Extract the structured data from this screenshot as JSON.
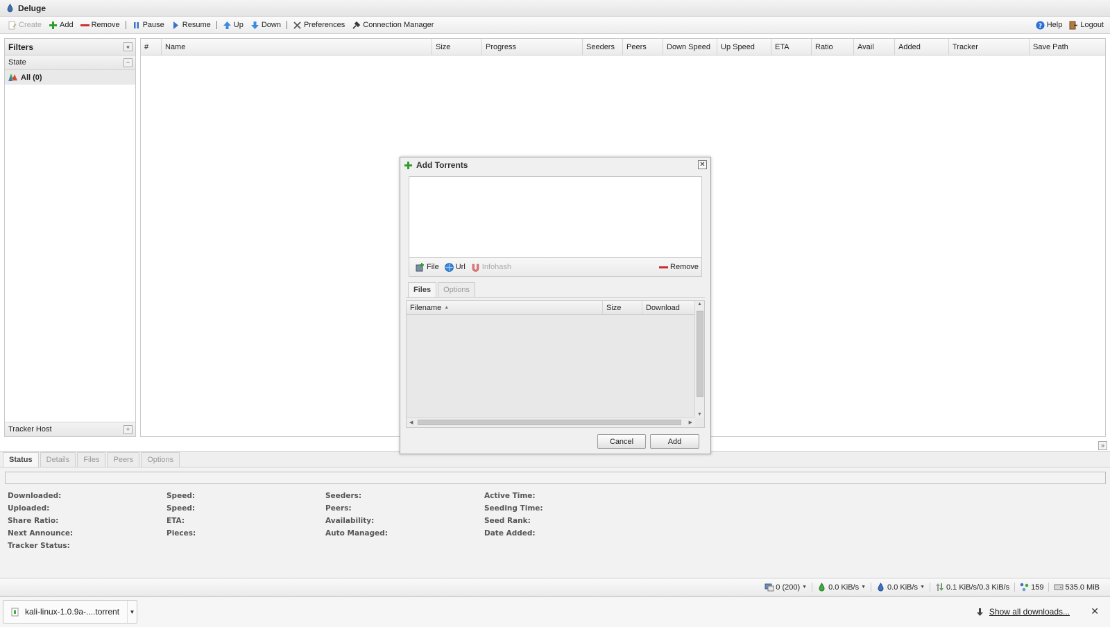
{
  "window": {
    "title": "Deluge"
  },
  "toolbar": {
    "create": "Create",
    "add": "Add",
    "remove": "Remove",
    "pause": "Pause",
    "resume": "Resume",
    "up": "Up",
    "down": "Down",
    "preferences": "Preferences",
    "connection_manager": "Connection Manager",
    "help": "Help",
    "logout": "Logout"
  },
  "filters": {
    "title": "Filters",
    "state_label": "State",
    "all_item": "All (0)",
    "tracker_host_label": "Tracker Host"
  },
  "grid": {
    "columns": [
      "#",
      "Name",
      "Size",
      "Progress",
      "Seeders",
      "Peers",
      "Down Speed",
      "Up Speed",
      "ETA",
      "Ratio",
      "Avail",
      "Added",
      "Tracker",
      "Save Path"
    ]
  },
  "dialog": {
    "title": "Add Torrents",
    "file_btn": "File",
    "url_btn": "Url",
    "infohash_btn": "Infohash",
    "remove_btn": "Remove",
    "tabs": [
      "Files",
      "Options"
    ],
    "file_columns": [
      "Filename",
      "Size",
      "Download"
    ],
    "cancel": "Cancel",
    "add": "Add"
  },
  "details": {
    "tabs": [
      "Status",
      "Details",
      "Files",
      "Peers",
      "Options"
    ],
    "col1": [
      "Downloaded:",
      "Uploaded:",
      "Share Ratio:",
      "Next Announce:",
      "Tracker Status:"
    ],
    "col2": [
      "Speed:",
      "Speed:",
      "ETA:",
      "Pieces:"
    ],
    "col3": [
      "Seeders:",
      "Peers:",
      "Availability:",
      "Auto Managed:"
    ],
    "col4": [
      "Active Time:",
      "Seeding Time:",
      "Seed Rank:",
      "Date Added:"
    ]
  },
  "statusbar": {
    "connections": "0 (200)",
    "download_speed": "0.0 KiB/s",
    "upload_speed": "0.0 KiB/s",
    "protocol_traffic": "0.1 KiB/s/0.3 KiB/s",
    "dht_nodes": "159",
    "free_space": "535.0 MiB"
  },
  "downloads": {
    "file_name": "kali-linux-1.0.9a-....torrent",
    "show_all": "Show all downloads..."
  },
  "colors": {
    "add_green": "#2f9e2f",
    "remove_red": "#c8302c",
    "blue_accent": "#2a6fd6"
  }
}
